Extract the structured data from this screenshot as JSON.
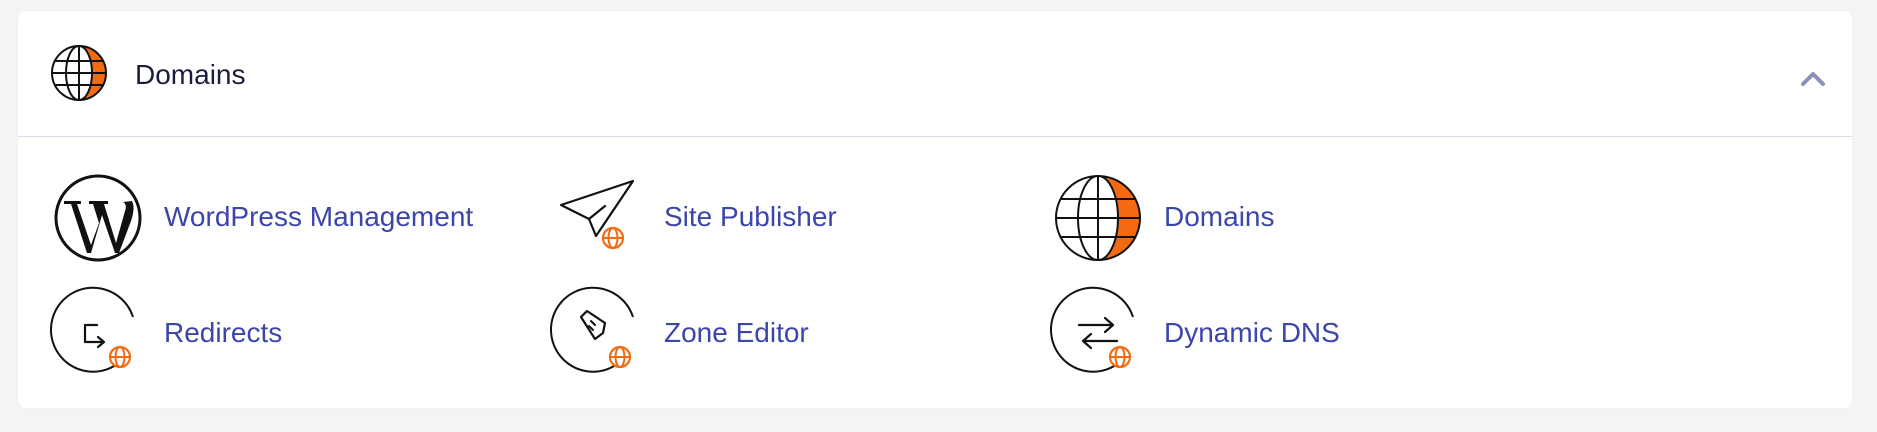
{
  "section": {
    "title": "Domains",
    "header_icon": "globe-icon",
    "collapse_icon": "chevron-up-icon"
  },
  "items": [
    {
      "label": "WordPress Management",
      "icon": "wordpress-icon"
    },
    {
      "label": "Site Publisher",
      "icon": "paper-plane-globe-icon"
    },
    {
      "label": "Domains",
      "icon": "globe-icon"
    },
    {
      "label": "Redirects",
      "icon": "redirect-globe-icon"
    },
    {
      "label": "Zone Editor",
      "icon": "zone-editor-globe-icon"
    },
    {
      "label": "Dynamic DNS",
      "icon": "dynamic-dns-globe-icon"
    }
  ],
  "colors": {
    "link": "#3c46a8",
    "accent_orange": "#f46a10",
    "title": "#1a1d3b",
    "chevron": "#8a90b8"
  }
}
